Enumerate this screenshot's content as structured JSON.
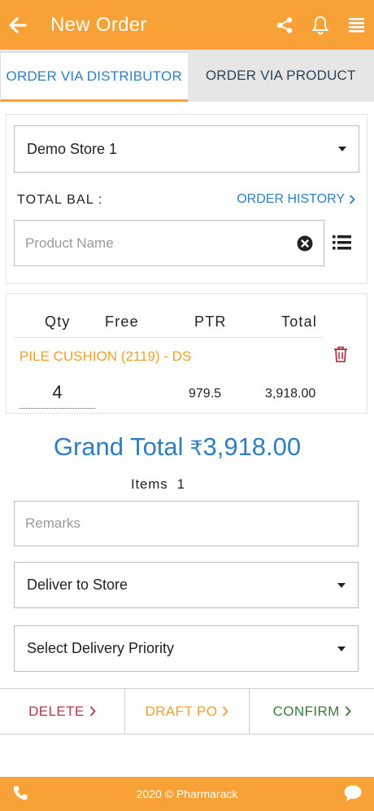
{
  "header": {
    "title": "New Order",
    "icons": [
      "back-arrow-icon",
      "share-icon",
      "bell-icon",
      "menu-icon"
    ]
  },
  "tabs": [
    {
      "label": "ORDER VIA DISTRIBUTOR",
      "active": true
    },
    {
      "label": "ORDER VIA PRODUCT",
      "active": false
    }
  ],
  "store_select": {
    "value": "Demo Store 1"
  },
  "balance": {
    "label": "TOTAL BAL :"
  },
  "order_history": {
    "label": "ORDER HISTORY"
  },
  "product_search": {
    "placeholder": "Product Name"
  },
  "order_table": {
    "headers": {
      "qty": "Qty",
      "free": "Free",
      "ptr": "PTR",
      "total": "Total"
    },
    "rows": [
      {
        "product": "PILE CUSHION (2119) - DS",
        "qty": "4",
        "free": "",
        "ptr": "979.5",
        "total": "3,918.00"
      }
    ]
  },
  "summary": {
    "grand_total_label": "Grand Total",
    "currency": "₹",
    "grand_total_value": "3,918.00",
    "items_label": "Items",
    "items_count": "1"
  },
  "remarks": {
    "placeholder": "Remarks"
  },
  "deliver_select": {
    "value": "Deliver to Store"
  },
  "priority_select": {
    "value": "Select Delivery Priority"
  },
  "actions": {
    "delete": "DELETE",
    "draft": "DRAFT PO",
    "confirm": "CONFIRM"
  },
  "footer": {
    "text": "2020 © Pharmarack"
  },
  "colors": {
    "brand_orange": "#f8a137",
    "link_blue": "#2f7ec1",
    "product_orange": "#f0a02b",
    "delete_red": "#b23a48",
    "draft_orange": "#f0a02b",
    "confirm_green": "#3c7a3a"
  }
}
